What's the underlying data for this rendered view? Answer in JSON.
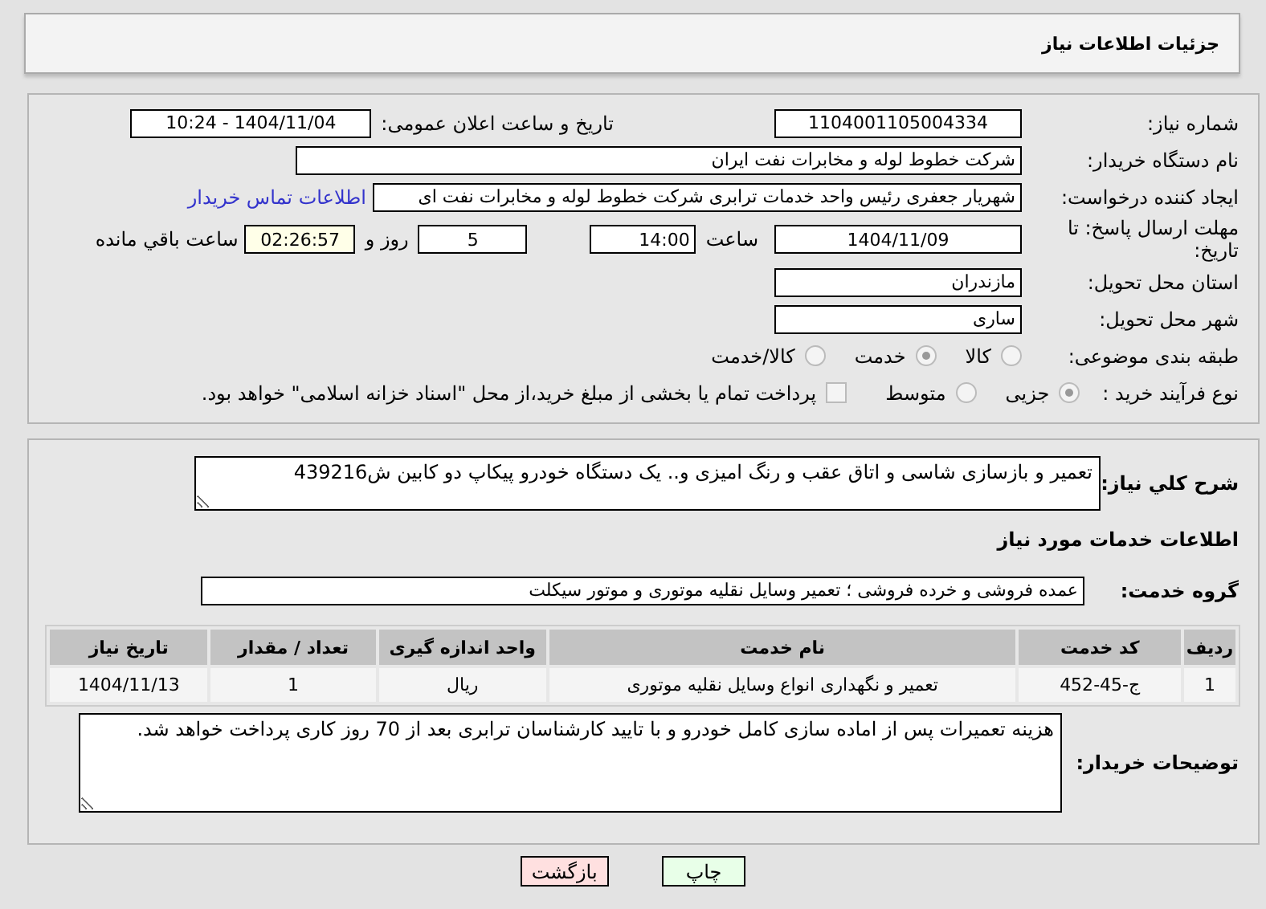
{
  "header": {
    "title": "جزئیات اطلاعات نیاز"
  },
  "need_number": {
    "label": "شماره نیاز:",
    "value": "1104001105004334"
  },
  "announce": {
    "label": "تاریخ و ساعت اعلان عمومی:",
    "value": "1404/11/04 - 10:24"
  },
  "buyer_org": {
    "label": "نام دستگاه خریدار:",
    "value": "شرکت خطوط لوله و مخابرات نفت ایران"
  },
  "requester": {
    "label": "ایجاد کننده درخواست:",
    "value": "شهریار  جعفری  رئیس واحد خدمات ترابری  شرکت خطوط لوله و مخابرات نفت ای",
    "link": "اطلاعات تماس خریدار"
  },
  "deadline": {
    "label": "مهلت ارسال پاسخ: تا تاریخ:",
    "date": "1404/11/09",
    "time_label": "ساعت",
    "time": "14:00",
    "days": "5",
    "days_label": "روز و",
    "remaining": "02:26:57",
    "remaining_label": "ساعت باقي مانده"
  },
  "province": {
    "label": "استان محل تحویل:",
    "value": "مازندران"
  },
  "city": {
    "label": "شهر محل تحویل:",
    "value": "ساری"
  },
  "category": {
    "label": "طبقه بندی موضوعی:",
    "options": [
      {
        "label": "کالا",
        "selected": false
      },
      {
        "label": "خدمت",
        "selected": true
      },
      {
        "label": "کالا/خدمت",
        "selected": false
      }
    ]
  },
  "process": {
    "label": "نوع فرآیند خرید :",
    "options": [
      {
        "label": "جزیی",
        "selected": true
      },
      {
        "label": "متوسط",
        "selected": false
      }
    ],
    "payment": {
      "label": "پرداخت تمام یا بخشی از مبلغ خرید،از محل \"اسناد خزانه اسلامی\" خواهد بود.",
      "checked": false
    }
  },
  "description": {
    "label": "شرح کلي نیاز:",
    "value": "تعمیر و بازسازی شاسی و اتاق عقب و رنگ امیزی و.. یک دستگاه خودرو پیکاپ دو کابین ش439216"
  },
  "services_heading": "اطلاعات خدمات مورد نیاز",
  "service_group": {
    "label": "گروه خدمت:",
    "value": "عمده فروشی و خرده فروشی ؛ تعمیر وسایل نقلیه موتوری و موتور سیکلت"
  },
  "table": {
    "columns": [
      "ردیف",
      "کد خدمت",
      "نام خدمت",
      "واحد اندازه گیری",
      "تعداد / مقدار",
      "تاریخ نیاز"
    ],
    "rows": [
      [
        "1",
        "ج-45-452",
        "تعمیر و نگهداری انواع وسایل نقلیه موتوری",
        "ریال",
        "1",
        "1404/11/13"
      ]
    ]
  },
  "buyer_notes": {
    "label": "توضیحات خریدار:",
    "value": "هزینه تعمیرات پس از اماده سازی کامل خودرو و با تایید کارشناسان ترابری بعد از 70 روز کاری پرداخت خواهد شد."
  },
  "buttons": [
    {
      "label": "چاپ",
      "kind": "print"
    },
    {
      "label": "بازگشت",
      "kind": "back"
    }
  ]
}
